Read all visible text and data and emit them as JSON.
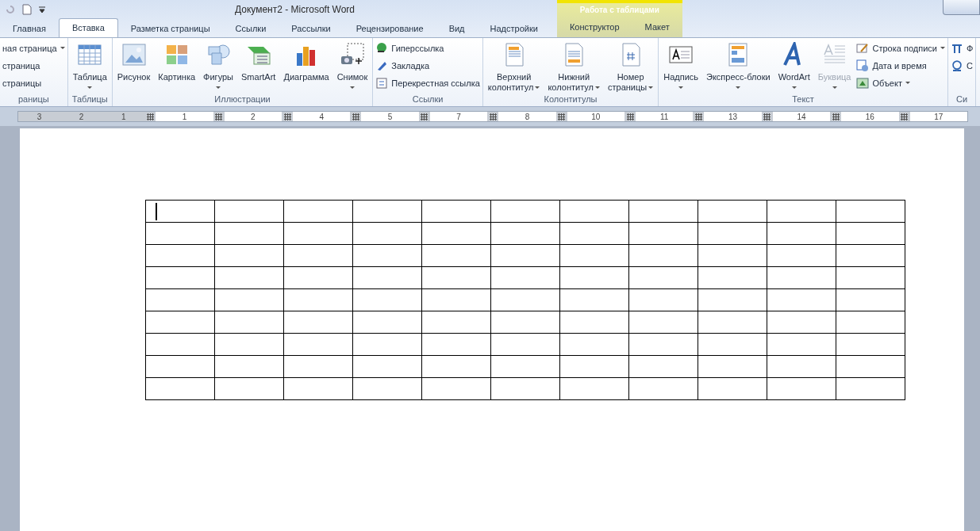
{
  "window": {
    "title": "Документ2 - Microsoft Word"
  },
  "tabs": [
    {
      "label": "Главная",
      "selected": false
    },
    {
      "label": "Вставка",
      "selected": true
    },
    {
      "label": "Разметка страницы",
      "selected": false
    },
    {
      "label": "Ссылки",
      "selected": false
    },
    {
      "label": "Рассылки",
      "selected": false
    },
    {
      "label": "Рецензирование",
      "selected": false
    },
    {
      "label": "Вид",
      "selected": false
    },
    {
      "label": "Надстройки",
      "selected": false
    }
  ],
  "context_tabs": {
    "title": "Работа с таблицами",
    "tabs": [
      {
        "label": "Конструктор",
        "selected": false
      },
      {
        "label": "Макет",
        "selected": false
      }
    ]
  },
  "ribbon_groups": [
    {
      "label": "раницы",
      "small_buttons": [
        {
          "kind": "coverpage",
          "label": "ная страница",
          "dropdown": true,
          "disabled": false
        },
        {
          "kind": "blankpage",
          "label": "страница",
          "dropdown": false,
          "disabled": false
        },
        {
          "kind": "pagebreak",
          "label": "страницы",
          "dropdown": false,
          "disabled": false
        }
      ]
    },
    {
      "label": "Таблицы",
      "large_buttons": [
        {
          "kind": "table",
          "lines": [
            "Таблица"
          ],
          "dropdown": true,
          "disabled": false
        }
      ]
    },
    {
      "label": "Иллюстрации",
      "large_buttons": [
        {
          "kind": "image",
          "lines": [
            "Рисунок"
          ],
          "dropdown": false,
          "disabled": false
        },
        {
          "kind": "clipart",
          "lines": [
            "Картинка"
          ],
          "dropdown": false,
          "disabled": false
        },
        {
          "kind": "shapes",
          "lines": [
            "Фигуры"
          ],
          "dropdown": true,
          "disabled": false
        },
        {
          "kind": "smartart",
          "lines": [
            "SmartArt"
          ],
          "dropdown": false,
          "disabled": false
        },
        {
          "kind": "chart",
          "lines": [
            "Диаграмма"
          ],
          "dropdown": false,
          "disabled": false
        },
        {
          "kind": "screenshot",
          "lines": [
            "Снимок"
          ],
          "dropdown": true,
          "disabled": false
        }
      ]
    },
    {
      "label": "Ссылки",
      "small_buttons": [
        {
          "kind": "hyperlink",
          "label": "Гиперссылка",
          "dropdown": false,
          "disabled": false
        },
        {
          "kind": "bookmark",
          "label": "Закладка",
          "dropdown": false,
          "disabled": false
        },
        {
          "kind": "crossref",
          "label": "Перекрестная ссылка",
          "dropdown": false,
          "disabled": false
        }
      ]
    },
    {
      "label": "Колонтитулы",
      "large_buttons": [
        {
          "kind": "header",
          "lines": [
            "Верхний",
            "колонтитул"
          ],
          "dropdown": true,
          "disabled": false
        },
        {
          "kind": "footer",
          "lines": [
            "Нижний",
            "колонтитул"
          ],
          "dropdown": true,
          "disabled": false
        },
        {
          "kind": "pagenum",
          "lines": [
            "Номер",
            "страницы"
          ],
          "dropdown": true,
          "disabled": false
        }
      ]
    },
    {
      "label": "Текст",
      "large_buttons": [
        {
          "kind": "textbox",
          "lines": [
            "Надпись"
          ],
          "dropdown": true,
          "disabled": false
        },
        {
          "kind": "quickparts",
          "lines": [
            "Экспресс-блоки"
          ],
          "dropdown": true,
          "disabled": false
        },
        {
          "kind": "wordart",
          "lines": [
            "WordArt"
          ],
          "dropdown": true,
          "disabled": false
        },
        {
          "kind": "dropcap",
          "lines": [
            "Буквица"
          ],
          "dropdown": true,
          "disabled": true
        }
      ],
      "small_buttons": [
        {
          "kind": "signature",
          "label": "Строка подписи",
          "dropdown": true,
          "disabled": false
        },
        {
          "kind": "datetime",
          "label": "Дата и время",
          "dropdown": false,
          "disabled": false
        },
        {
          "kind": "object",
          "label": "Объект",
          "dropdown": true,
          "disabled": false
        }
      ]
    },
    {
      "label": "Си",
      "small_buttons": [
        {
          "kind": "equation",
          "label": "Ф",
          "dropdown": false,
          "disabled": false
        },
        {
          "kind": "symbol",
          "label": "С",
          "dropdown": false,
          "disabled": false
        }
      ]
    }
  ],
  "ruler": {
    "segments": [
      {
        "kind": "margin",
        "labels": [
          "3",
          "2",
          "1"
        ]
      },
      {
        "kind": "text",
        "labels": [
          "1"
        ]
      },
      {
        "kind": "text",
        "labels": [
          "2"
        ]
      },
      {
        "kind": "text",
        "labels": [
          "4"
        ]
      },
      {
        "kind": "text",
        "labels": [
          "5"
        ]
      },
      {
        "kind": "text",
        "labels": [
          "7"
        ]
      },
      {
        "kind": "text",
        "labels": [
          "8"
        ]
      },
      {
        "kind": "text",
        "labels": [
          "10"
        ]
      },
      {
        "kind": "text",
        "labels": [
          "11"
        ]
      },
      {
        "kind": "text",
        "labels": [
          "13"
        ]
      },
      {
        "kind": "text",
        "labels": [
          "14"
        ]
      },
      {
        "kind": "text",
        "labels": [
          "16"
        ]
      },
      {
        "kind": "text",
        "labels": [
          "17"
        ]
      }
    ]
  },
  "table": {
    "rows": [
      {
        "cells": [
          {
            "caret": true
          },
          {
            "caret": false
          },
          {
            "caret": false
          },
          {
            "caret": false
          },
          {
            "caret": false
          },
          {
            "caret": false
          },
          {
            "caret": false
          },
          {
            "caret": false
          },
          {
            "caret": false
          },
          {
            "caret": false
          },
          {
            "caret": false
          }
        ]
      },
      {
        "cells": [
          {
            "caret": false
          },
          {
            "caret": false
          },
          {
            "caret": false
          },
          {
            "caret": false
          },
          {
            "caret": false
          },
          {
            "caret": false
          },
          {
            "caret": false
          },
          {
            "caret": false
          },
          {
            "caret": false
          },
          {
            "caret": false
          },
          {
            "caret": false
          }
        ]
      },
      {
        "cells": [
          {
            "caret": false
          },
          {
            "caret": false
          },
          {
            "caret": false
          },
          {
            "caret": false
          },
          {
            "caret": false
          },
          {
            "caret": false
          },
          {
            "caret": false
          },
          {
            "caret": false
          },
          {
            "caret": false
          },
          {
            "caret": false
          },
          {
            "caret": false
          }
        ]
      },
      {
        "cells": [
          {
            "caret": false
          },
          {
            "caret": false
          },
          {
            "caret": false
          },
          {
            "caret": false
          },
          {
            "caret": false
          },
          {
            "caret": false
          },
          {
            "caret": false
          },
          {
            "caret": false
          },
          {
            "caret": false
          },
          {
            "caret": false
          },
          {
            "caret": false
          }
        ]
      },
      {
        "cells": [
          {
            "caret": false
          },
          {
            "caret": false
          },
          {
            "caret": false
          },
          {
            "caret": false
          },
          {
            "caret": false
          },
          {
            "caret": false
          },
          {
            "caret": false
          },
          {
            "caret": false
          },
          {
            "caret": false
          },
          {
            "caret": false
          },
          {
            "caret": false
          }
        ]
      },
      {
        "cells": [
          {
            "caret": false
          },
          {
            "caret": false
          },
          {
            "caret": false
          },
          {
            "caret": false
          },
          {
            "caret": false
          },
          {
            "caret": false
          },
          {
            "caret": false
          },
          {
            "caret": false
          },
          {
            "caret": false
          },
          {
            "caret": false
          },
          {
            "caret": false
          }
        ]
      },
      {
        "cells": [
          {
            "caret": false
          },
          {
            "caret": false
          },
          {
            "caret": false
          },
          {
            "caret": false
          },
          {
            "caret": false
          },
          {
            "caret": false
          },
          {
            "caret": false
          },
          {
            "caret": false
          },
          {
            "caret": false
          },
          {
            "caret": false
          },
          {
            "caret": false
          }
        ]
      },
      {
        "cells": [
          {
            "caret": false
          },
          {
            "caret": false
          },
          {
            "caret": false
          },
          {
            "caret": false
          },
          {
            "caret": false
          },
          {
            "caret": false
          },
          {
            "caret": false
          },
          {
            "caret": false
          },
          {
            "caret": false
          },
          {
            "caret": false
          },
          {
            "caret": false
          }
        ]
      },
      {
        "cells": [
          {
            "caret": false
          },
          {
            "caret": false
          },
          {
            "caret": false
          },
          {
            "caret": false
          },
          {
            "caret": false
          },
          {
            "caret": false
          },
          {
            "caret": false
          },
          {
            "caret": false
          },
          {
            "caret": false
          },
          {
            "caret": false
          },
          {
            "caret": false
          }
        ]
      }
    ]
  }
}
